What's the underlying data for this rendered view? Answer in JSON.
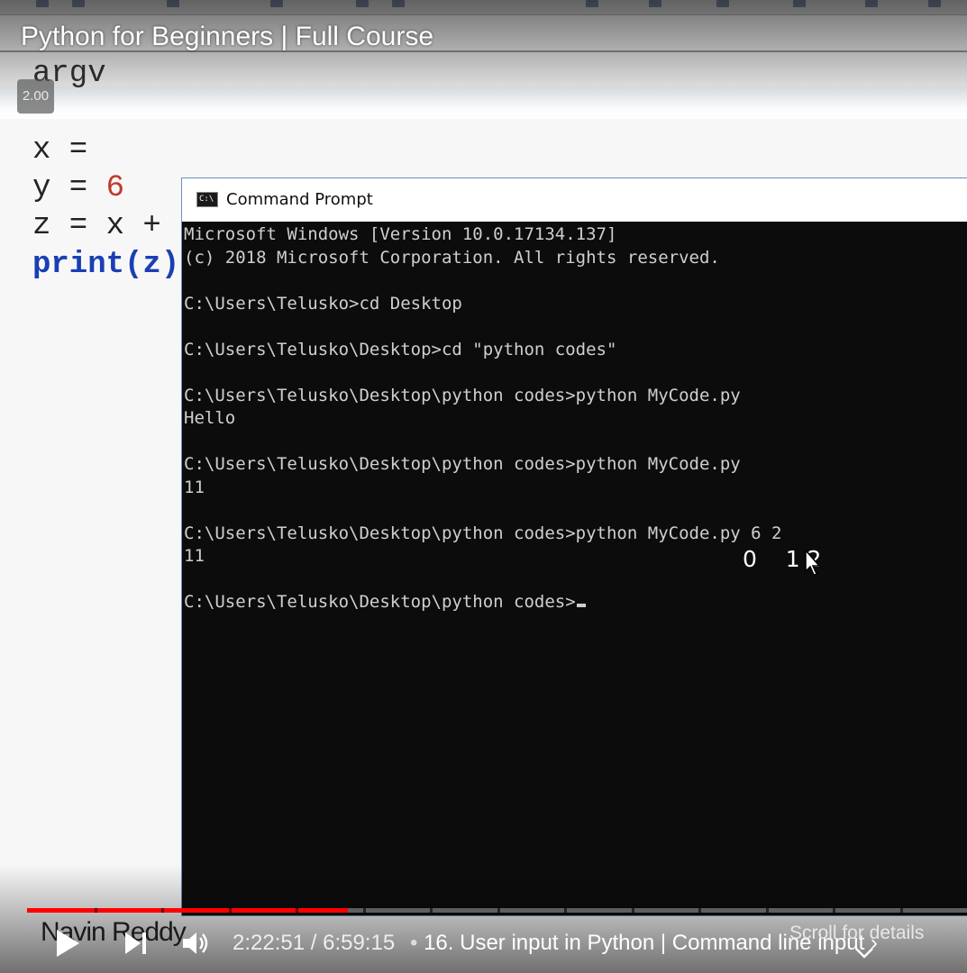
{
  "player": {
    "video_title": "Python for Beginners | Full Course",
    "speed": "2.00",
    "current_time": "2:22:51",
    "time_separator": "/",
    "duration": "6:59:15",
    "chapter_bullet": "•",
    "chapter": "16. User input in Python | Command line input",
    "chapter_chevron": "›",
    "scroll_hint": "Scroll for details",
    "watermark": "Navin Reddy",
    "progress_fraction": 0.341,
    "progress_color": "#ff0000",
    "icons": {
      "play": "play-icon",
      "next": "next-icon",
      "volume": "volume-icon",
      "scroll": "chevron-down-icon"
    }
  },
  "editor": {
    "lines": {
      "argv": "argv",
      "x": "x =",
      "y_prefix": "y = ",
      "y_value": "6",
      "z": "z = x +",
      "print": "print(z)"
    }
  },
  "cmd": {
    "title": "Command Prompt",
    "icon_label": "C:\\",
    "lines": [
      "Microsoft Windows [Version 10.0.17134.137]",
      "(c) 2018 Microsoft Corporation. All rights reserved.",
      "",
      "C:\\Users\\Telusko>cd Desktop",
      "",
      "C:\\Users\\Telusko\\Desktop>cd \"python codes\"",
      "",
      "C:\\Users\\Telusko\\Desktop\\python codes>python MyCode.py",
      "Hello",
      "",
      "C:\\Users\\Telusko\\Desktop\\python codes>python MyCode.py",
      "11",
      "",
      "C:\\Users\\Telusko\\Desktop\\python codes>python MyCode.py 6 2",
      "11",
      "",
      "C:\\Users\\Telusko\\Desktop\\python codes>"
    ],
    "annotation": "0    1 2"
  }
}
